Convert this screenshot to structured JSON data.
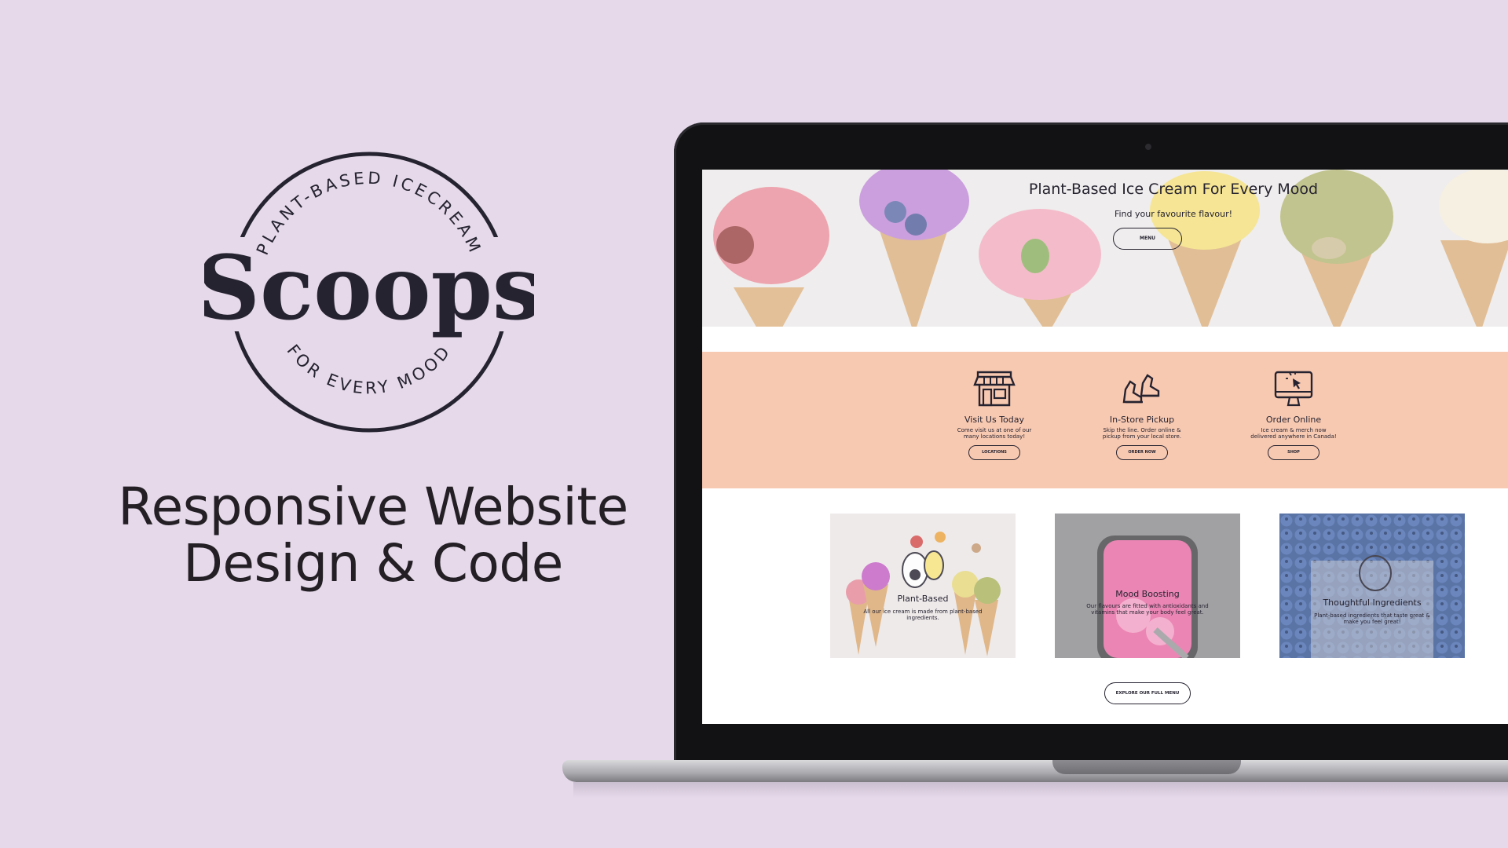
{
  "brand": {
    "arc_top": "PLANT-BASED ICECREAM",
    "name": "Scoops",
    "arc_bottom": "FOR EVERY MOOD"
  },
  "headline": {
    "line1": "Responsive Website",
    "line2": "Design & Code"
  },
  "website": {
    "hero": {
      "title": "Plant-Based Ice Cream For Every Mood",
      "subtitle": "Find your favourite flavour!",
      "button": "MENU"
    },
    "features": [
      {
        "icon": "storefront-icon",
        "title": "Visit Us Today",
        "text": "Come visit us at one of our many locations today!",
        "button": "LOCATIONS"
      },
      {
        "icon": "walking-feet-icon",
        "title": "In-Store Pickup",
        "text": "Skip the line. Order online & pickup from your local store.",
        "button": "ORDER NOW"
      },
      {
        "icon": "computer-click-icon",
        "title": "Order Online",
        "text": "Ice cream & merch now delivered anywhere in Canada!",
        "button": "SHOP"
      }
    ],
    "cards": [
      {
        "title": "Plant-Based",
        "text": "All our ice cream is made from plant-based ingredients."
      },
      {
        "title": "Mood Boosting",
        "text": "Our flavours are fitted with antioxidants and vitamins that make your body feel great."
      },
      {
        "title": "Thoughtful Ingredients",
        "text": "Plant-based ingredients that taste great & make you feel great!"
      }
    ],
    "explore_button": "EXPLORE OUR FULL MENU"
  },
  "colors": {
    "page_background": "#e5d9ea",
    "brand_dark": "#262330",
    "peach_band": "#f8c9b1"
  }
}
